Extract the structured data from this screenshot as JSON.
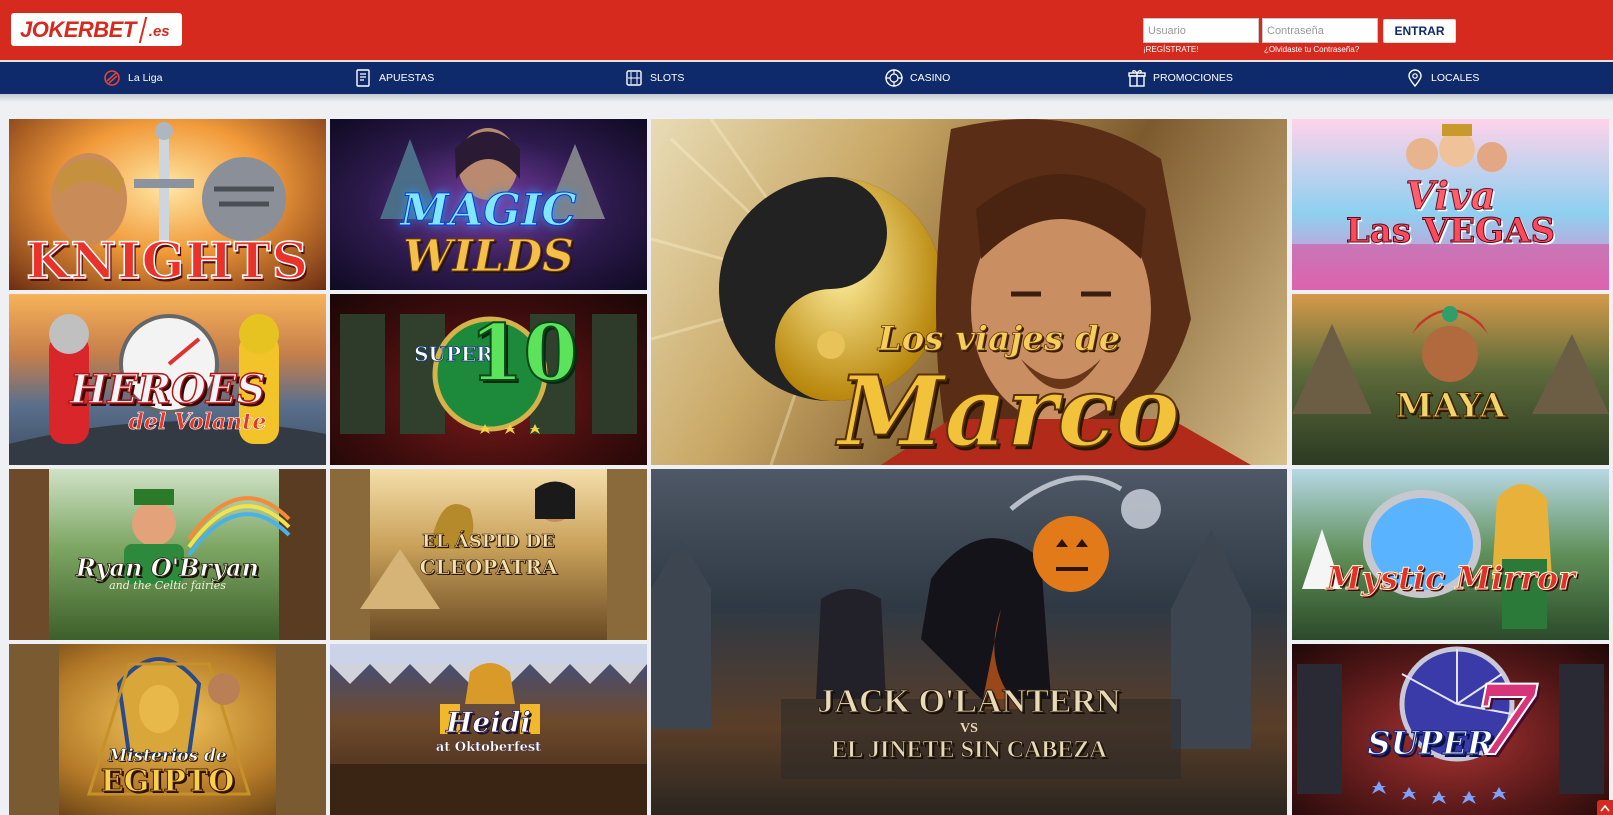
{
  "header": {
    "logo": {
      "brand": "JOKERBET",
      "tld": ".es"
    },
    "login": {
      "user_placeholder": "Usuario",
      "password_placeholder": "Contraseña",
      "submit_label": "ENTRAR",
      "register_link": "¡REGÍSTRATE!",
      "forgot_link": "¿Olvidaste tu Contraseña?"
    }
  },
  "nav": {
    "items": [
      {
        "label": "La Liga",
        "icon": "laliga-icon"
      },
      {
        "label": "APUESTAS",
        "icon": "betslip-icon"
      },
      {
        "label": "SLOTS",
        "icon": "slot-machine-icon"
      },
      {
        "label": "CASINO",
        "icon": "roulette-chip-icon"
      },
      {
        "label": "PROMOCIONES",
        "icon": "gift-icon"
      },
      {
        "label": "LOCALES",
        "icon": "location-pin-icon"
      }
    ]
  },
  "games": {
    "knights": {
      "title": "KNIGHTS"
    },
    "magic": {
      "line1": "MAGIC",
      "line2": "WILDS"
    },
    "marco": {
      "line1": "Los viajes de",
      "line2": "Marco"
    },
    "vegas": {
      "line1": "Viva",
      "line2": "Las VEGAS"
    },
    "heroes": {
      "line1": "HEROES",
      "line2": "del Volante"
    },
    "super10": {
      "line1": "SUPER",
      "line2": "10"
    },
    "maya": {
      "title": "MAYA"
    },
    "ryan": {
      "line1": "Ryan O'Bryan",
      "line2": "and the Celtic fairies"
    },
    "cleo": {
      "line1": "EL ÁSPID DE",
      "line2": "CLEOPATRA"
    },
    "jack": {
      "line1": "JACK O'LANTERN",
      "vs": "VS",
      "line2": "EL JINETE SIN CABEZA"
    },
    "mystic": {
      "title": "Mystic Mirror"
    },
    "egipto": {
      "line1": "Misterios de",
      "line2": "EGIPTO"
    },
    "heidi": {
      "line1": "Heidi",
      "line2": "at Oktoberfest"
    },
    "super7": {
      "line1": "SUPER",
      "line2": "7"
    }
  },
  "colors": {
    "brand_red": "#d72a1f",
    "nav_blue": "#0e2a6a",
    "white": "#ffffff"
  }
}
